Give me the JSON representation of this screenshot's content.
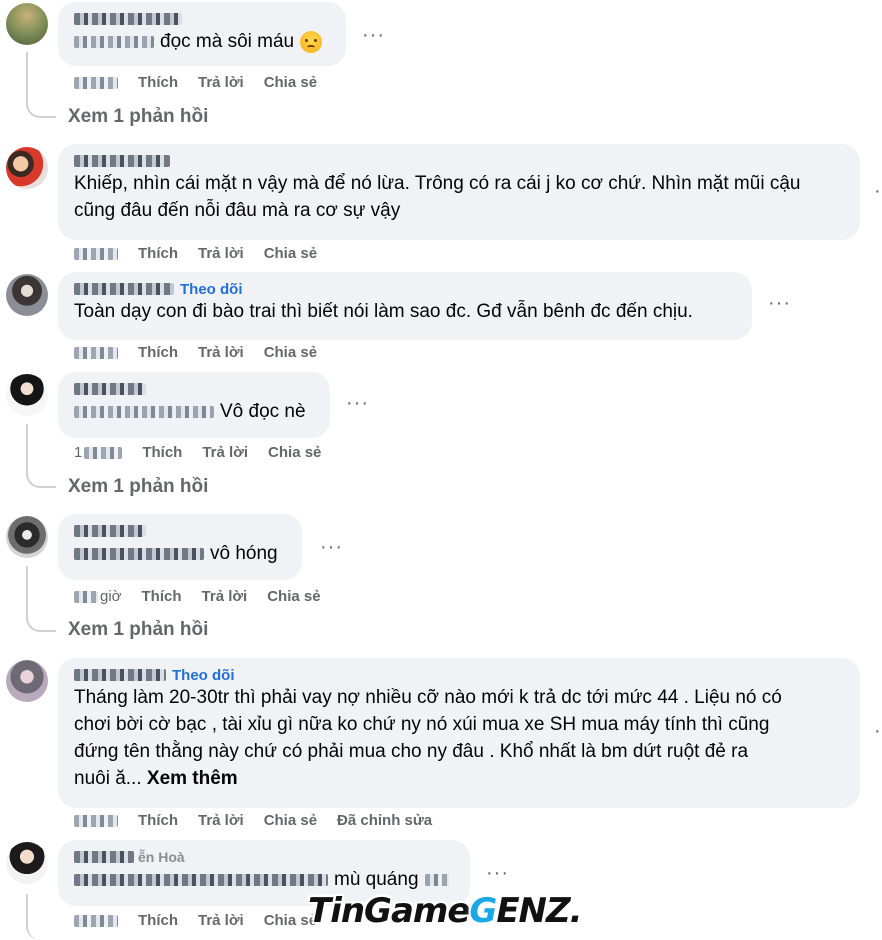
{
  "actions": {
    "like": "Thích",
    "reply": "Trả lời",
    "share": "Chia sẻ",
    "edited": "Đã chỉnh sửa",
    "follow": "Theo dõi",
    "more": "···"
  },
  "comments": [
    {
      "text": "đọc mà sôi máu",
      "emoji": "sad-face-emoji",
      "replies": "Xem 1 phản hồi"
    },
    {
      "text_lines": [
        "Khiếp, nhìn cái mặt n vậy mà để nó lừa. Trông có ra cái j ko cơ chứ. Nhìn mặt mũi cậu",
        "cũng đâu đến nỗi đâu mà ra cơ sự vậy"
      ]
    },
    {
      "text": "Toàn dạy con đi bào trai thì biết nói làm sao đc. Gđ vẫn bênh đc đến chịu."
    },
    {
      "text": "Vô đọc nè",
      "time": "1",
      "replies": "Xem 1 phản hồi"
    },
    {
      "text": "vô hóng",
      "time_suffix": "giờ",
      "replies": "Xem 1 phản hồi"
    },
    {
      "text_lines": [
        "Tháng làm 20-30tr thì phải vay nợ nhiều cỡ nào mới k trả dc tới mức 44 . Liệu nó có",
        "chơi bời cờ bạc , tài xỉu gì nữa ko chứ ny nó xúi mua xe SH mua máy tính thì cũng",
        "đứng tên thằng này chứ có phải mua cho ny đâu . Khổ nhất là bm dứt ruột đẻ ra"
      ],
      "last_line": "nuôi ă...",
      "see_more": "Xem thêm"
    },
    {
      "author_visible": "ễn Hoà",
      "text": "mù quáng"
    }
  ],
  "watermark": {
    "part1": "TinGame",
    "part2": "G",
    "part3": "ENZ."
  }
}
